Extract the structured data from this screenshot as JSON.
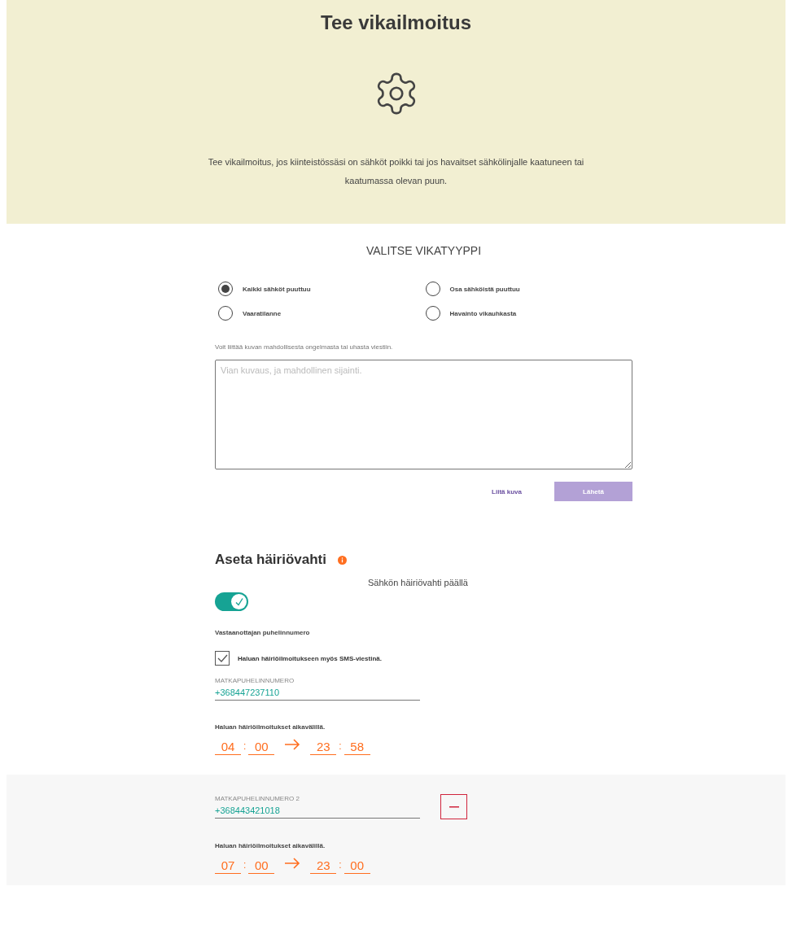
{
  "banner": {
    "title": "Tee vikailmoitus",
    "description": "Tee vikailmoitus, jos kiinteistössäsi on sähköt poikki tai jos havaitset sähkölinjalle kaatuneen tai kaatumassa olevan puun."
  },
  "fault_form": {
    "heading": "VALITSE VIKATYYPPI",
    "options": [
      {
        "label": "Kaikki sähköt puuttuu",
        "selected": true
      },
      {
        "label": "Osa sähköistä puuttuu",
        "selected": false
      },
      {
        "label": "Vaaratilanne",
        "selected": false
      },
      {
        "label": "Havainto vikauhkasta",
        "selected": false
      }
    ],
    "hint": "Voit liittää kuvan mahdollisesta ongelmasta tai uhasta viestiin.",
    "description_field": {
      "placeholder": "Vian kuvaus, ja mahdollinen sijainti."
    },
    "attach_link": "Liitä kuva",
    "send_button": {
      "label": "Lähetä",
      "disabled": true
    }
  },
  "watch": {
    "heading": "Aseta häiriövahti",
    "toggle": {
      "label": "Sähkön häiriövahti päällä",
      "on": true
    },
    "recipient_label": "Vastaanottajan puhelinnumero",
    "sms_checkbox": {
      "label": "Haluan häiriöilmoitukseen myös SMS-viestinä.",
      "checked": true
    },
    "numbers": [
      {
        "label": "MATKAPUHELINNUMERO",
        "value": "+368447237110",
        "removable": false,
        "range_label": "Haluan häiriöilmoitukset aikavälillä.",
        "start": [
          "04",
          "00"
        ],
        "end": [
          "23",
          "58"
        ],
        "separator": ":"
      },
      {
        "label": "MATKAPUHELINNUMERO 2",
        "value": "+368443421018",
        "removable": true,
        "range_label": "Haluan häiriöilmoitukset aikavälillä.",
        "start": [
          "07",
          "00"
        ],
        "end": [
          "23",
          "00"
        ],
        "separator": ":"
      }
    ]
  }
}
